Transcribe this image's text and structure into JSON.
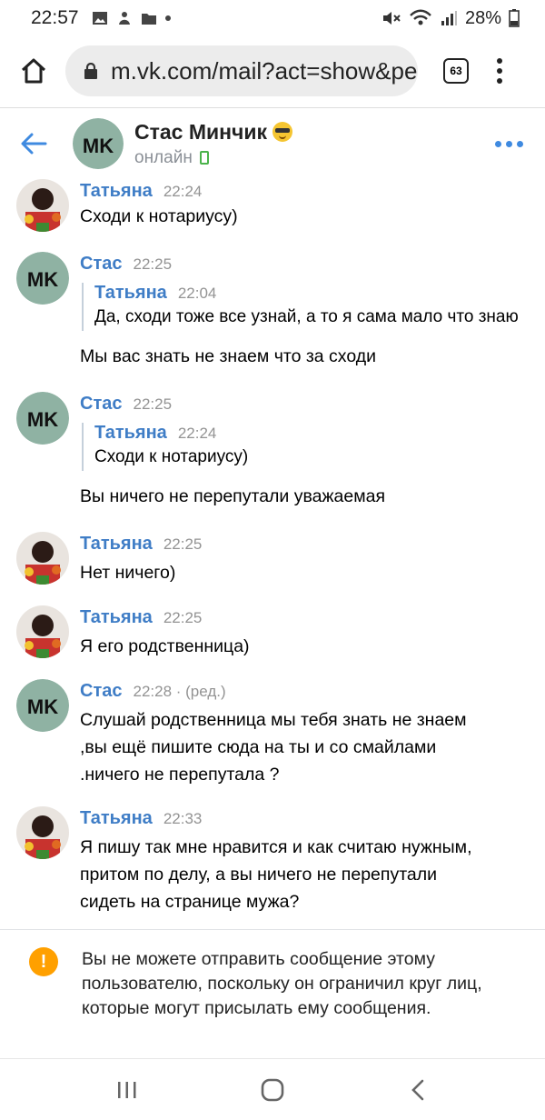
{
  "status_bar": {
    "time": "22:57",
    "battery": "28%",
    "icons": [
      "image-icon",
      "app-icon",
      "folder-icon",
      "dot-icon",
      "mute-icon",
      "wifi-icon",
      "signal-icon",
      "battery-icon"
    ]
  },
  "browser": {
    "url": "m.vk.com/mail?act=show&peer=",
    "tab_count": "63"
  },
  "chat": {
    "name": "Стас Минчик",
    "status": "онлайн",
    "avatar_text": "MK"
  },
  "messages": [
    {
      "author": "Татьяна",
      "time": "22:24",
      "lines": [
        "Сходи к нотариусу)"
      ]
    },
    {
      "author": "Стас",
      "time": "22:25",
      "quote": {
        "author": "Татьяна",
        "time": "22:04",
        "text": "Да, сходи тоже все узнай, а то я сама мало что знаю"
      },
      "lines": [
        "Мы вас знать не знаем что за сходи"
      ]
    },
    {
      "author": "Стас",
      "time": "22:25",
      "quote": {
        "author": "Татьяна",
        "time": "22:24",
        "text": "Сходи к нотариусу)"
      },
      "lines": [
        "Вы ничего не перепутали уважаемая"
      ]
    },
    {
      "author": "Татьяна",
      "time": "22:25",
      "lines": [
        "Нет ничего)"
      ]
    },
    {
      "author": "Татьяна",
      "time": "22:25",
      "lines": [
        "Я его родственница)"
      ]
    },
    {
      "author": "Стас",
      "time": "22:28 · (ред.)",
      "lines": [
        "Слушай родственница мы тебя знать не знаем",
        ",вы ещё пишите сюда на ты и со смайлами",
        ".ничего не перепутала ?"
      ]
    },
    {
      "author": "Татьяна",
      "time": "22:33",
      "lines": [
        "Я пишу так мне нравится и как считаю нужным,",
        "притом по делу, а вы ничего не перепутали",
        "сидеть на странице мужа?"
      ]
    }
  ],
  "notice": {
    "icon": "!",
    "text": "Вы не можете отправить сообщение этому пользователю, поскольку он ограничил круг лиц, которые могут присылать ему сообщения."
  },
  "colors": {
    "accent": "#3f8ae0",
    "author_blue": "#3f7dc6",
    "warning": "#ffa000",
    "online": "#4bb34b"
  }
}
